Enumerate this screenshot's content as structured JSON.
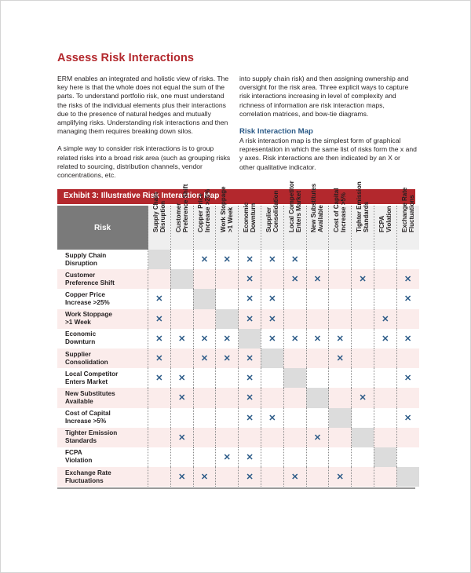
{
  "page": {
    "title": "Assess Risk Interactions",
    "left_paragraphs": [
      "ERM enables an integrated and holistic view of risks. The key here is that the whole does not equal the sum of the parts. To understand portfolio risk, one must understand the risks of the individual elements plus their interactions due to the presence of natural hedges and mutually amplifying risks. Understanding risk interactions and then managing them requires breaking down silos.",
      "A simple way to consider risk interactions is to group related risks into a broad risk area (such as grouping risks related to sourcing, distribution channels, vendor concentrations, etc."
    ],
    "right_paragraph": "into supply chain risk) and then assigning ownership and oversight for the risk area. Three explicit ways to capture risk interactions increasing in level of complexity and richness of information are risk interaction maps, correlation matrices, and bow-tie diagrams.",
    "subheading": "Risk Interaction Map",
    "subheading_paragraph": "A risk interaction map is the simplest form of graphical representation in which the same list of risks form the x and y axes. Risk interactions are then indicated by an X or other qualitative indicator."
  },
  "exhibit": {
    "title": "Exhibit 3: Illustrative Risk Interaction Map",
    "corner_label": "Risk",
    "mark_symbol": "✕",
    "colors": {
      "accent": "#b3282d",
      "mark": "#2b5a87",
      "alt_row": "#fbeceb",
      "self_cell": "#dcdcdc"
    },
    "risks": [
      {
        "line1": "Supply Chain",
        "line2": "Disruption",
        "interactions": [
          3,
          4,
          5,
          6,
          7
        ]
      },
      {
        "line1": "Customer",
        "line2": "Preference Shift",
        "interactions": [
          5,
          7,
          8,
          10,
          12
        ]
      },
      {
        "line1": "Copper Price",
        "line2": "Increase >25%",
        "interactions": [
          1,
          5,
          6,
          12
        ]
      },
      {
        "line1": "Work Stoppage",
        "line2": ">1 Week",
        "interactions": [
          1,
          5,
          6,
          11
        ]
      },
      {
        "line1": "Economic",
        "line2": "Downturn",
        "interactions": [
          1,
          2,
          3,
          4,
          6,
          7,
          8,
          9,
          11,
          12
        ]
      },
      {
        "line1": "Supplier",
        "line2": "Consolidation",
        "interactions": [
          1,
          3,
          4,
          5,
          9
        ]
      },
      {
        "line1": "Local Competitor",
        "line2": "Enters Market",
        "interactions": [
          1,
          2,
          5,
          12
        ]
      },
      {
        "line1": "New Substitutes",
        "line2": "Available",
        "interactions": [
          2,
          5,
          10
        ]
      },
      {
        "line1": "Cost of Capital",
        "line2": "Increase >5%",
        "interactions": [
          5,
          6,
          12
        ]
      },
      {
        "line1": "Tighter Emission",
        "line2": "Standards",
        "interactions": [
          2,
          8
        ]
      },
      {
        "line1": "FCPA",
        "line2": "Violation",
        "interactions": [
          4,
          5
        ]
      },
      {
        "line1": "Exchange Rate",
        "line2": "Fluctuations",
        "interactions": [
          2,
          3,
          5,
          7,
          9
        ]
      }
    ]
  }
}
